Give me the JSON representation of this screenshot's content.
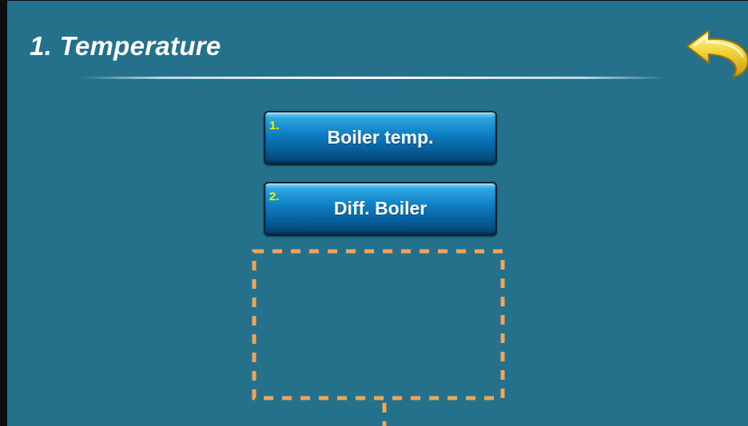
{
  "screen": {
    "title": "1. Temperature"
  },
  "menu": {
    "items": [
      {
        "number": "1.",
        "label": "Boiler temp."
      },
      {
        "number": "2.",
        "label": "Diff. Boiler"
      }
    ]
  },
  "icons": {
    "back": "back-arrow-icon"
  },
  "colors": {
    "background": "#23718b",
    "button_blue": "#0e7fc4",
    "number_yellow": "#f4f20e",
    "dashed_outline": "#f0a55a",
    "back_arrow": "#f4d63c"
  }
}
